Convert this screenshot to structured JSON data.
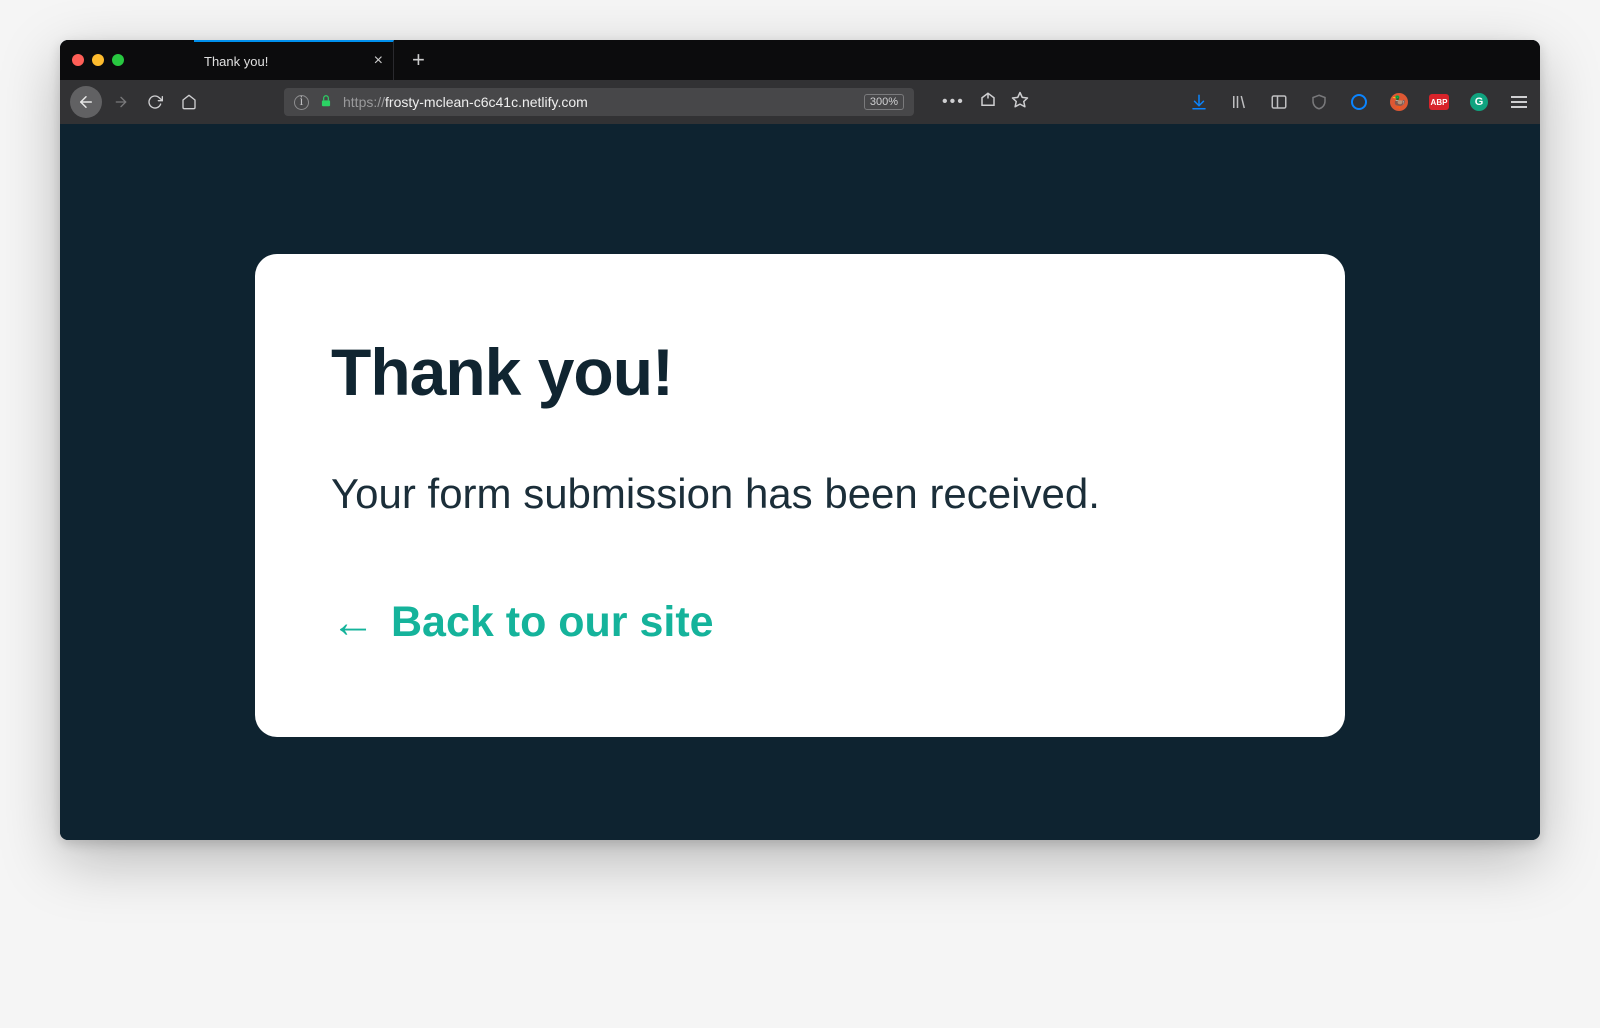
{
  "browser": {
    "tab_title": "Thank you!",
    "url_protocol": "https://",
    "url_host": "frosty-mclean-c6c41c.netlify.com",
    "zoom": "300%",
    "extensions": {
      "abp_label": "ABP",
      "grammarly_label": "G"
    }
  },
  "page": {
    "heading": "Thank you!",
    "message": "Your form submission has been received.",
    "back_link_text": "Back to our site"
  }
}
